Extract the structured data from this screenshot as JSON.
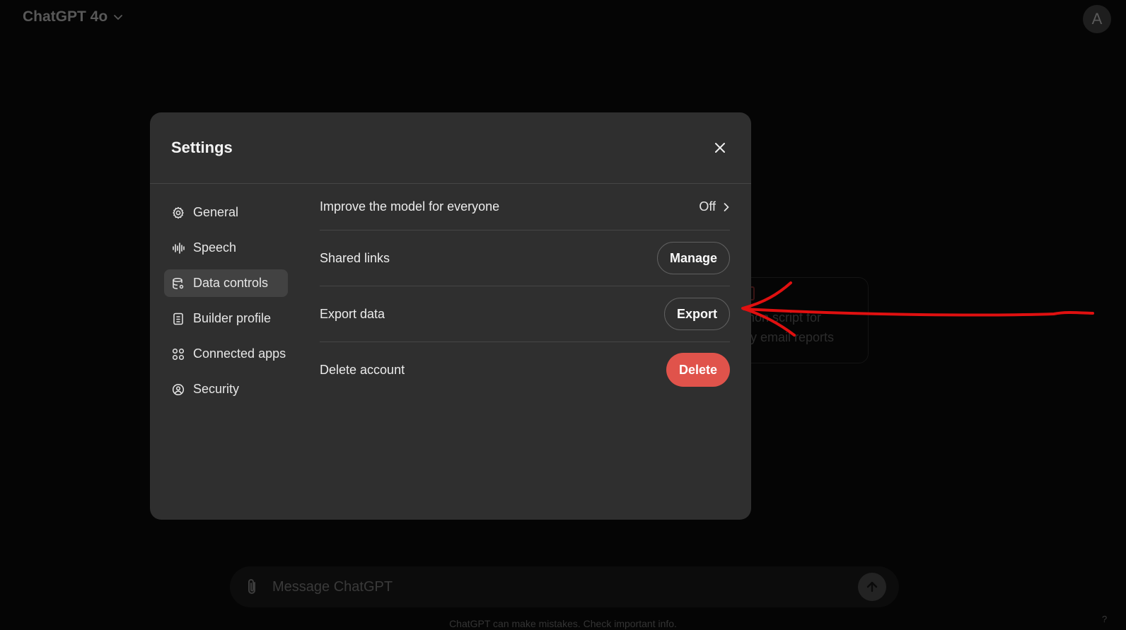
{
  "header": {
    "model_label": "ChatGPT 4o",
    "avatar_initial": "A"
  },
  "background_card": {
    "line1": "ython script for",
    "line2": "aily email reports"
  },
  "settings": {
    "title": "Settings",
    "nav": [
      {
        "label": "General",
        "icon": "gear-icon"
      },
      {
        "label": "Speech",
        "icon": "waveform-icon"
      },
      {
        "label": "Data controls",
        "icon": "database-icon",
        "active": true
      },
      {
        "label": "Builder profile",
        "icon": "id-card-icon"
      },
      {
        "label": "Connected apps",
        "icon": "apps-grid-icon"
      },
      {
        "label": "Security",
        "icon": "shield-user-icon"
      }
    ],
    "rows": {
      "improve": {
        "label": "Improve the model for everyone",
        "value": "Off"
      },
      "shared_links": {
        "label": "Shared links",
        "button": "Manage"
      },
      "export": {
        "label": "Export data",
        "button": "Export"
      },
      "delete": {
        "label": "Delete account",
        "button": "Delete"
      }
    }
  },
  "composer": {
    "placeholder": "Message ChatGPT"
  },
  "footer": {
    "disclaimer": "ChatGPT can make mistakes. Check important info.",
    "help": "?"
  },
  "colors": {
    "modal_bg": "#2f2f2f",
    "active_nav_bg": "#424242",
    "danger": "#e0534b",
    "annotation": "#e01010"
  }
}
